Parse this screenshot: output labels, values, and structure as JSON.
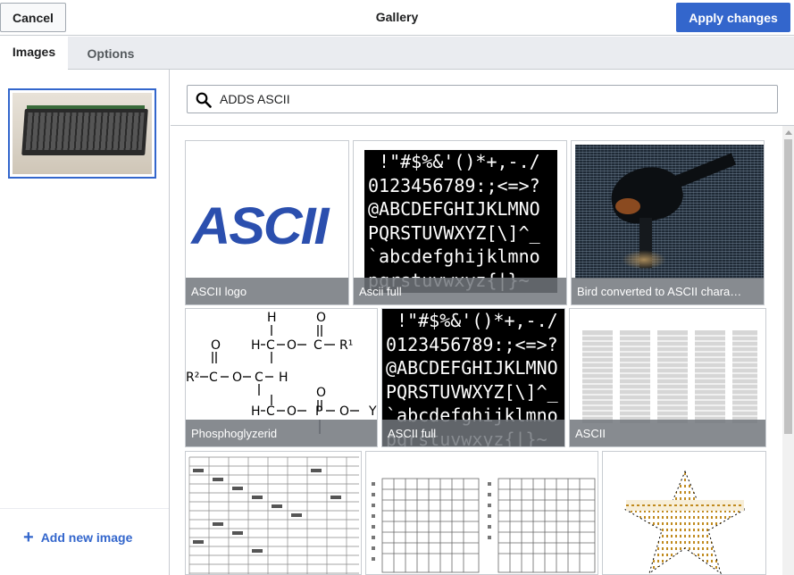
{
  "header": {
    "cancel_label": "Cancel",
    "title": "Gallery",
    "apply_label": "Apply changes"
  },
  "tabs": [
    {
      "label": "Images",
      "active": true
    },
    {
      "label": "Options",
      "active": false
    }
  ],
  "sidebar": {
    "add_new_label": "Add new image"
  },
  "search": {
    "value": "ADDS ASCII"
  },
  "results": [
    {
      "caption": "ASCII logo",
      "logo_text": "ASCII"
    },
    {
      "caption": "Ascii full",
      "chars": " !\"#$%&'()*+,-./\n0123456789:;<=>?\n@ABCDEFGHIJKLMNO\nPQRSTUVWXYZ[\\]^_\n`abcdefghijklmno\npqrstuvwxyz{|}~"
    },
    {
      "caption": "Bird converted to ASCII chara…"
    },
    {
      "caption": "Phosphoglyzerid"
    },
    {
      "caption": "ASCII full",
      "chars": " !\"#$%&'()*+,-./\n0123456789:;<=>?\n@ABCDEFGHIJKLMNO\nPQRSTUVWXYZ[\\]^_\n`abcdefghijklmno\npqrstuvwxyz{|}~"
    },
    {
      "caption": "ASCII"
    }
  ],
  "chem": {
    "H": "H",
    "O": "O",
    "C": "C",
    "P": "P",
    "Y": "Y",
    "R1": "R¹",
    "R2": "R²"
  },
  "colors": {
    "accent": "#3366cc",
    "border": "#c8ccd1",
    "tabbar": "#eaecf0"
  }
}
